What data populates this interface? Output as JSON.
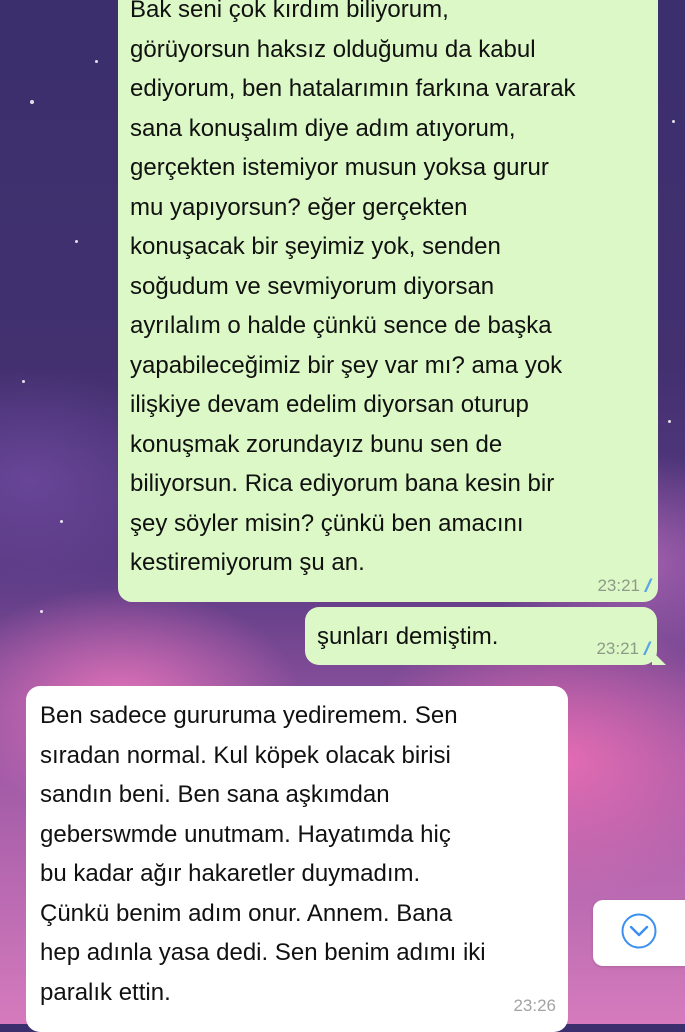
{
  "messages": [
    {
      "direction": "outgoing",
      "text": "Bak seni çok kırdım biliyorum,\ngörüyorsun haksız olduğumu da kabul\nediyorum, ben hatalarımın farkına vararak\nsana konuşalım diye adım atıyorum,\ngerçekten istemiyor musun yoksa gurur\nmu yapıyorsun? eğer gerçekten\nkonuşacak bir şeyimiz yok, senden\nsoğudum ve sevmiyorum diyorsan\nayrılalım o halde çünkü sence de başka\nyapabileceğimiz bir şey var mı? ama yok\nilişkiye devam edelim diyorsan oturup\nkonuşmak zorundayız bunu sen de\nbiliyorsun. Rica ediyorum bana kesin bir\nşey söyler misin? çünkü ben amacını\nkestiremiyorum şu an.",
      "time": "23:21",
      "status": "read"
    },
    {
      "direction": "outgoing",
      "text": "şunları demiştim.",
      "time": "23:21",
      "status": "read"
    },
    {
      "direction": "incoming",
      "text": "Ben sadece gururuma yediremem. Sen\nsıradan normal. Kul köpek olacak birisi\nsandın beni. Ben sana aşkımdan\ngeberswmde unutmam. Hayatımda hiç\nbu kadar ağır hakaretler duymadım.\nÇünkü benim adım onur. Annem. Bana\nhep adınla yasa dedi. Sen benim adımı iki\nparalık ettin.",
      "time": "23:26"
    }
  ],
  "scroll_button": {
    "icon": "chevron-down-circle-icon",
    "color": "#3b8ff0"
  },
  "colors": {
    "outgoing_bubble": "#dcf8c6",
    "incoming_bubble": "#ffffff",
    "read_ticks": "#5aa5e6"
  }
}
